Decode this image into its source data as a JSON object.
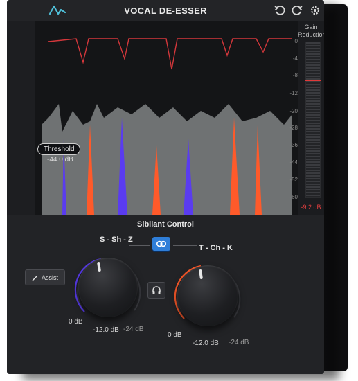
{
  "header": {
    "title": "VOCAL DE-ESSER",
    "icons": [
      "logo-wave-icon",
      "undo-icon",
      "redo-icon",
      "gear-icon",
      "power-icon"
    ]
  },
  "meter": {
    "title_line1": "Gain",
    "title_line2": "Reduction",
    "value": "-9.2 dB",
    "scale": [
      "0",
      "-4",
      "-8",
      "-12",
      "-20",
      "-28",
      "-36",
      "-44",
      "-52",
      "-60"
    ]
  },
  "threshold": {
    "label": "Threshold",
    "value": "-44.0 dB"
  },
  "sibilant": {
    "title": "Sibilant Control",
    "left_band": "S - Sh - Z",
    "right_band": "T - Ch - K",
    "assist_label": "Assist",
    "left_knob": {
      "min": "0 dB",
      "value": "-12.0 dB",
      "max": "-24 dB"
    },
    "right_knob": {
      "min": "0 dB",
      "value": "-12.0 dB",
      "max": "-24 dB"
    }
  },
  "colors": {
    "accent_blue": "#2f7ed8",
    "threshold_line": "#3f6fd6",
    "reduction_red": "#e03a3a",
    "sibilance_violet": "#5a3cf0",
    "sibilance_orange": "#ff5a2a",
    "signal_gray": "#7a7d7e"
  }
}
